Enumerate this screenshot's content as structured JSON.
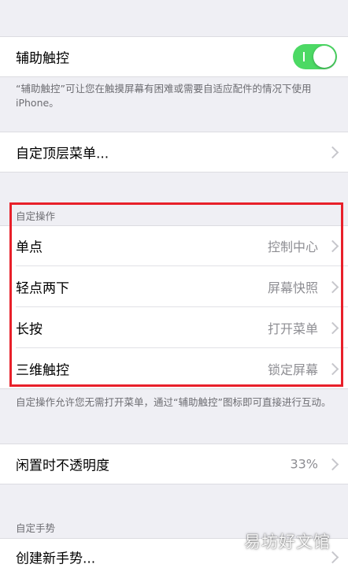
{
  "assistive_touch": {
    "label": "辅助触控",
    "toggle_on": true,
    "note": "“辅助触控”可让您在触摸屏幕有困难或需要自适应配件的情况下使用 iPhone。"
  },
  "customize_top_menu": {
    "label": "自定顶层菜单..."
  },
  "custom_actions": {
    "header": "自定操作",
    "rows": [
      {
        "label": "单点",
        "value": "控制中心"
      },
      {
        "label": "轻点两下",
        "value": "屏幕快照"
      },
      {
        "label": "长按",
        "value": "打开菜单"
      },
      {
        "label": "三维触控",
        "value": "锁定屏幕"
      }
    ],
    "note": "自定操作允许您无需打开菜单，通过“辅助触控”图标即可直接进行互动。"
  },
  "idle_opacity": {
    "label": "闲置时不透明度",
    "value": "33%"
  },
  "custom_gestures": {
    "header": "自定手势",
    "create_label": "创建新手势..."
  },
  "watermark": "易坊好文馆",
  "colors": {
    "toggle": "#4cd964",
    "highlight": "#e8202a"
  }
}
